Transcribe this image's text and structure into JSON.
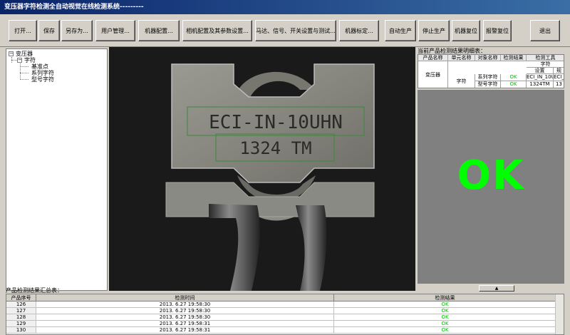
{
  "window": {
    "title": "变压器字符检测全自动视觉在线检测系统---------"
  },
  "toolbar": {
    "buttons": [
      {
        "label": "打开..."
      },
      {
        "label": "保存"
      },
      {
        "label": "另存为..."
      },
      {
        "label": "用户管理..."
      },
      {
        "label": "机器配置..."
      },
      {
        "label": "相机配置及其参数设置..."
      },
      {
        "label": "马达、信号、开关设置与测试..."
      },
      {
        "label": "机器标定..."
      },
      {
        "label": "自动生产"
      },
      {
        "label": "停止生产"
      },
      {
        "label": "机器复位"
      },
      {
        "label": "报警复位"
      },
      {
        "label": "退出"
      }
    ]
  },
  "tree": {
    "root": "变压器",
    "child": "字符",
    "leaves": [
      "基准点",
      "系列字符",
      "型号字符"
    ]
  },
  "image_view": {
    "line1": "ECI-IN-10UHN",
    "line2": "1324  TM"
  },
  "detail": {
    "label": "当前产品检测结果明细表：",
    "headers": [
      "产品名称",
      "单元名称",
      "对象名称",
      "检测结果",
      "检测工具"
    ],
    "tool_sub1": "字符",
    "tool_sub2": "设置",
    "tool_sub3": "规",
    "product": "变压器",
    "unit": "字符",
    "rows": [
      {
        "object": "系列字符",
        "result": "OK",
        "setting": "ECI_IN_10UH",
        "extra": "ECI_I"
      },
      {
        "object": "型号字符",
        "result": "OK",
        "setting": "1324TM",
        "extra": "13"
      }
    ]
  },
  "result": {
    "status": "OK",
    "arrow": "▲"
  },
  "summary": {
    "label": "产品检测结果汇总表：",
    "headers": [
      "产品序号",
      "检测时间",
      "检测结果"
    ],
    "rows": [
      {
        "id": "126",
        "time": "2013. 6.27 19:58:30",
        "result": "OK"
      },
      {
        "id": "127",
        "time": "2013. 6.27 19:58:30",
        "result": "OK"
      },
      {
        "id": "128",
        "time": "2013. 6.27 19:58:30",
        "result": "OK"
      },
      {
        "id": "129",
        "time": "2013. 6.27 19:58:31",
        "result": "OK"
      },
      {
        "id": "130",
        "time": "2013. 6.27 19:58:31",
        "result": "OK"
      }
    ]
  },
  "colors": {
    "ok_green": "#00ff00",
    "title_bar": "#0a246a",
    "panel_bg": "#d4d0c8"
  }
}
